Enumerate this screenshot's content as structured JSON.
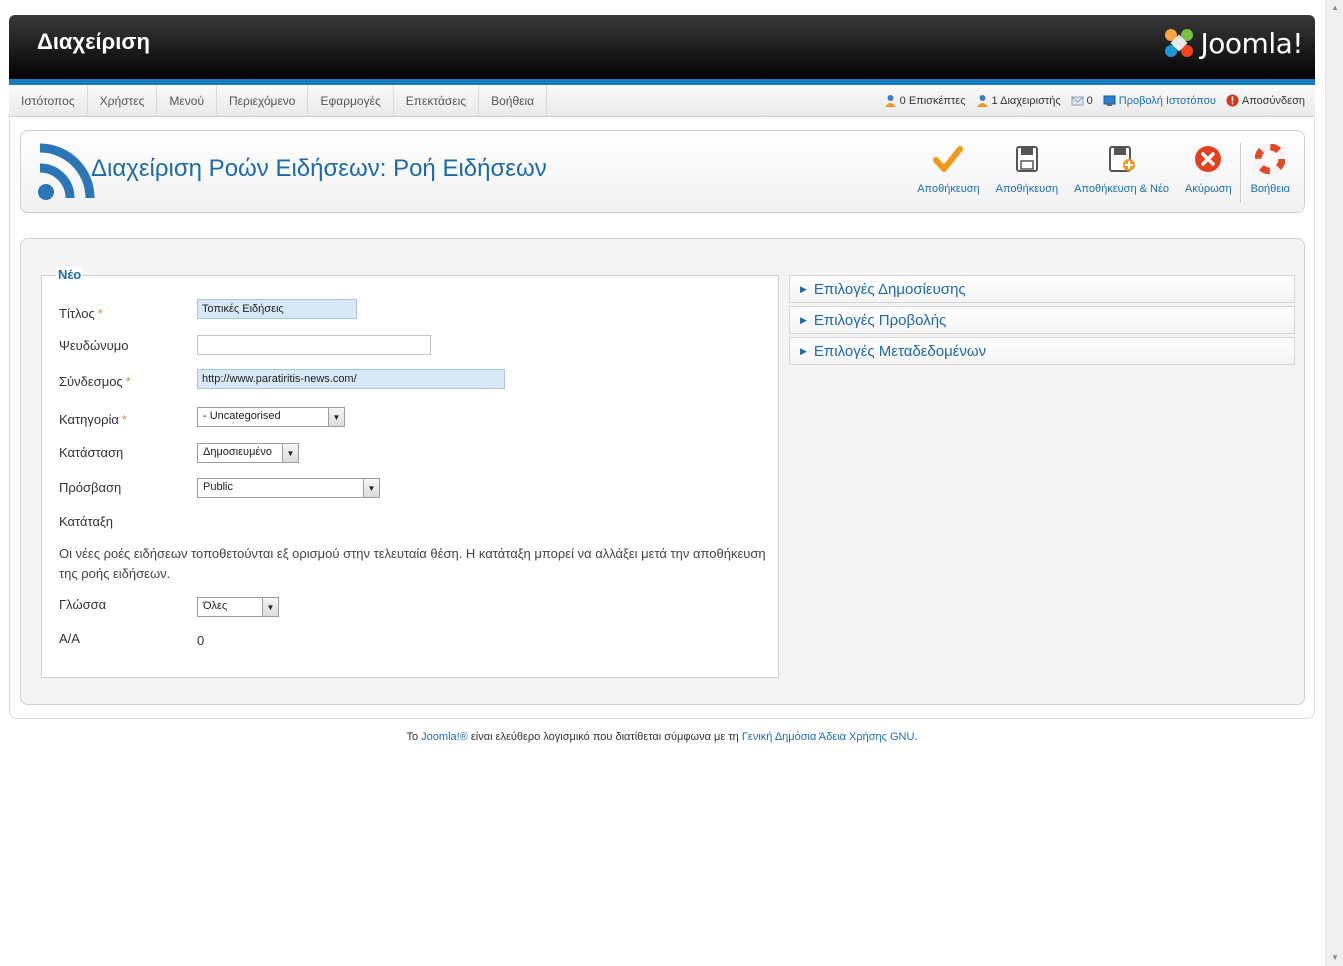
{
  "header": {
    "title": "Διαχείριση",
    "logo_text": "Joomla!"
  },
  "menu": {
    "items": [
      "Ιστότοπος",
      "Χρήστες",
      "Μενού",
      "Περιεχόμενο",
      "Εφαρμογές",
      "Επεκτάσεις",
      "Βοήθεια"
    ]
  },
  "status": {
    "visitors": "0 Επισκέπτες",
    "admins": "1 Διαχειριστής",
    "messages": "0",
    "view_site": "Προβολή Ιστοτόπου",
    "logout": "Αποσύνδεση"
  },
  "toolbar": {
    "page_title": "Διαχείριση Ροών Ειδήσεων: Ροή Ειδήσεων",
    "buttons": [
      "Αποθήκευση",
      "Αποθήκευση",
      "Αποθήκευση & Νέο",
      "Ακύρωση",
      "Βοήθεια"
    ]
  },
  "form": {
    "legend": "Νέο",
    "fields": {
      "title": {
        "label": "Τίτλος",
        "required": "*",
        "value": "Τοπικές Ειδήσεις"
      },
      "alias": {
        "label": "Ψευδώνυμο",
        "value": ""
      },
      "link": {
        "label": "Σύνδεσμος",
        "required": "*",
        "value": "http://www.paratiritis-news.com/"
      },
      "category": {
        "label": "Κατηγορία",
        "required": "*",
        "value": "- Uncategorised"
      },
      "state": {
        "label": "Κατάσταση",
        "value": "Δημοσιευμένο"
      },
      "access": {
        "label": "Πρόσβαση",
        "value": "Public"
      },
      "ordering": {
        "label": "Κατάταξη"
      },
      "language": {
        "label": "Γλώσσα",
        "value": "Όλες"
      },
      "id": {
        "label": "Α/Α",
        "value": "0"
      }
    },
    "ordering_note": "Οι νέες ροές ειδήσεων τοποθετούνται εξ ορισμού στην τελευταία θέση. Η κατάταξη μπορεί να αλλάξει μετά την αποθήκευση της ροής ειδήσεων."
  },
  "panels": [
    "Επιλογές Δημοσίευσης",
    "Επιλογές Προβολής",
    "Επιλογές Μεταδεδομένων"
  ],
  "footer": {
    "prefix": "Το",
    "joomla_link": "Joomla!®",
    "middle": "είναι ελεύθερο λογισμικό που διατίθεται σύμφωνα με τη",
    "license_link": "Γενική Δημόσια Άδεια Χρήσης GNU",
    "suffix": "."
  },
  "colors": {
    "accent": "#1a7bc0",
    "link": "#1a6fb5",
    "title": "#1c6aa8",
    "required": "#e08a3b"
  }
}
